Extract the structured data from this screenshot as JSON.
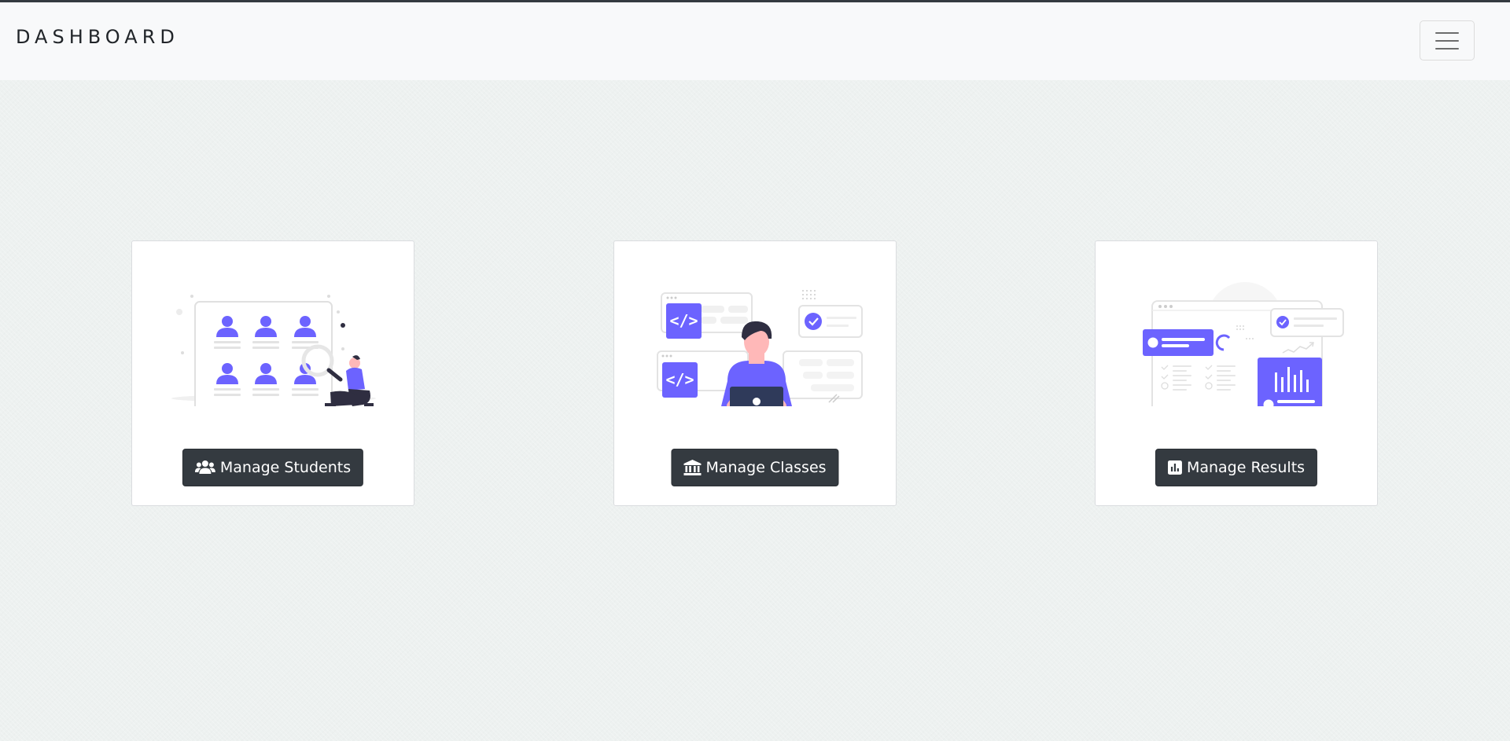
{
  "header": {
    "brand": "DASHBOARD",
    "menu_toggle_icon": "hamburger-icon"
  },
  "cards": [
    {
      "button_label": "Manage Students",
      "icon": "users-icon"
    },
    {
      "button_label": "Manage Classes",
      "icon": "institution-icon"
    },
    {
      "button_label": "Manage Results",
      "icon": "bar-chart-icon"
    }
  ],
  "colors": {
    "accent": "#6c63ff",
    "dark": "#343a40",
    "navy": "#2f2e41",
    "skin": "#ffb8b8",
    "background": "#edf1f0",
    "navbar": "#f8f9fa"
  }
}
